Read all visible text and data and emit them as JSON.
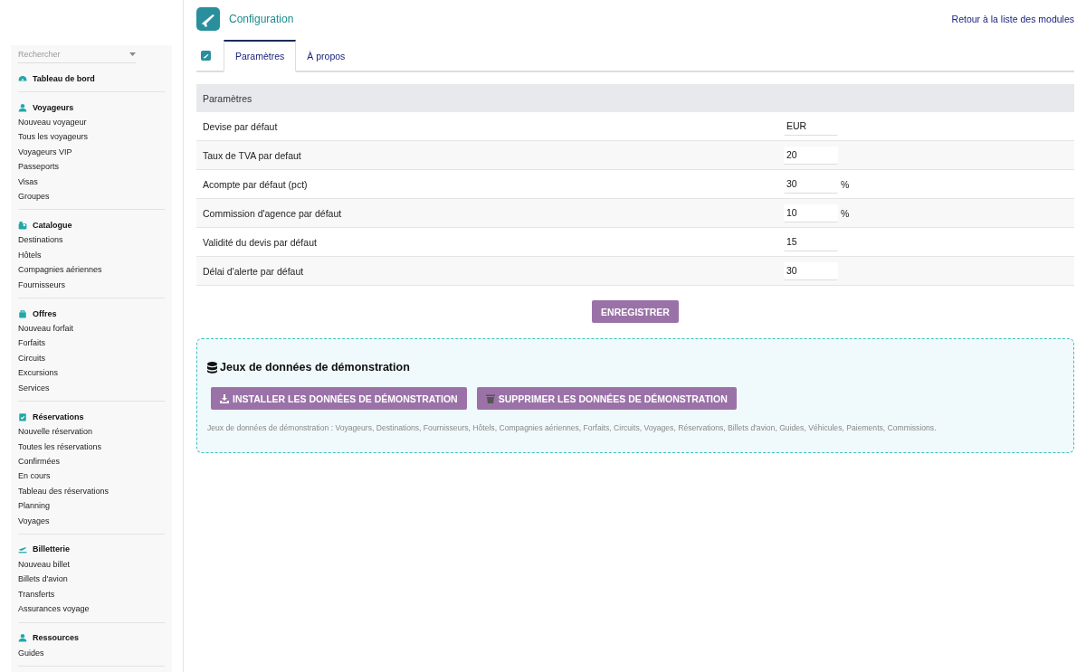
{
  "header": {
    "title": "Configuration",
    "back_link": "Retour à la liste des modules"
  },
  "sidebar": {
    "search": {
      "placeholder": "Rechercher"
    },
    "sections": [
      {
        "title": "Tableau de bord"
      },
      {
        "title": "Voyageurs",
        "items": [
          "Nouveau voyageur",
          "Tous les voyageurs",
          "Voyageurs VIP",
          "Passeports",
          "Visas",
          "Groupes"
        ]
      },
      {
        "title": "Catalogue",
        "items": [
          "Destinations",
          "Hôtels",
          "Compagnies aériennes",
          "Fournisseurs"
        ]
      },
      {
        "title": "Offres",
        "items": [
          "Nouveau forfait",
          "Forfaits",
          "Circuits",
          "Excursions",
          "Services"
        ]
      },
      {
        "title": "Réservations",
        "items": [
          "Nouvelle réservation",
          "Toutes les réservations",
          "Confirmées",
          "En cours",
          "Tableau des réservations",
          "Planning",
          "Voyages"
        ]
      },
      {
        "title": "Billetterie",
        "items": [
          "Nouveau billet",
          "Billets d'avion",
          "Transferts",
          "Assurances voyage"
        ]
      },
      {
        "title": "Ressources",
        "items": [
          "Guides"
        ]
      }
    ]
  },
  "tabs": [
    {
      "label": "Paramètres",
      "selected": true
    },
    {
      "label": "À propos",
      "selected": false
    }
  ],
  "settings": {
    "title": "Paramètres",
    "rows": [
      {
        "label": "Devise par défaut",
        "value": "EUR"
      },
      {
        "label": "Taux de TVA par defaut",
        "value": "20"
      },
      {
        "label": "Acompte par défaut (pct)",
        "value": "30",
        "unit": "%"
      },
      {
        "label": "Commission d'agence par défaut",
        "value": "10",
        "unit": "%"
      },
      {
        "label": "Validité du devis par défaut",
        "value": "15"
      },
      {
        "label": "Délai d'alerte par défaut",
        "value": "30"
      }
    ]
  },
  "save_button": "ENREGISTRER",
  "demo": {
    "title": "Jeux de données de démonstration",
    "buttons": [
      {
        "kind": "install",
        "label": "INSTALLER LES DONNÉES DE DÉMONSTRATION"
      },
      {
        "kind": "delete",
        "label": "SUPPRIMER LES DONNÉES DE DÉMONSTRATION"
      }
    ],
    "note": "Jeux de données de démonstration : Voyageurs, Destinations, Fournisseurs, Hôtels, Compagnies aériennes, Forfaits, Circuits, Voyages, Réservations, Billets d'avion, Guides, Véhicules, Paiements, Commissions."
  }
}
